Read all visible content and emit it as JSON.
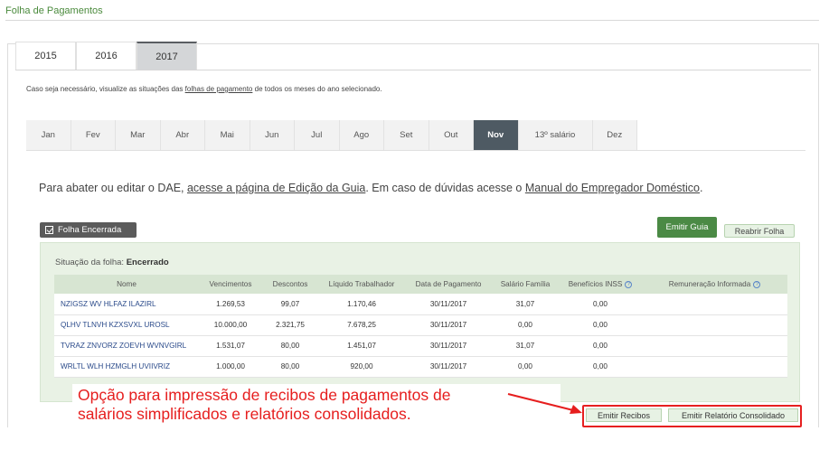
{
  "page_title": "Folha de Pagamentos",
  "year_tabs": [
    "2015",
    "2016",
    "2017"
  ],
  "active_year": "2017",
  "info": {
    "prefix": "Caso seja necessário, visualize as situações das ",
    "link": "folhas de pagamento",
    "suffix": " de todos os meses do ano selecionado."
  },
  "month_tabs": [
    "Jan",
    "Fev",
    "Mar",
    "Abr",
    "Mai",
    "Jun",
    "Jul",
    "Ago",
    "Set",
    "Out",
    "Nov",
    "13º salário",
    "Dez"
  ],
  "active_month": "Nov",
  "dae": {
    "prefix": "Para abater ou editar o DAE, ",
    "link1": "acesse a página de Edição da Guia",
    "middle": ". Em caso de dúvidas acesse o ",
    "link2": "Manual do Empregador Doméstico",
    "suffix": "."
  },
  "status_badge": "Folha Encerrada",
  "buttons": {
    "emitir_guia": "Emitir Guia",
    "reabrir_folha": "Reabrir Folha",
    "emitir_recibos": "Emitir Recibos",
    "emitir_relatorio": "Emitir Relatório Consolidado"
  },
  "situacao": {
    "label": "Situação da folha: ",
    "value": "Encerrado"
  },
  "table": {
    "headers": [
      "Nome",
      "Vencimentos",
      "Descontos",
      "Líquido Trabalhador",
      "Data de Pagamento",
      "Salário Família",
      "Benefícios INSS",
      "Remuneração Informada"
    ],
    "help_icon": "?",
    "rows": [
      [
        "NZIGSZ WV HLFAZ ILAZIRL",
        "1.269,53",
        "99,07",
        "1.170,46",
        "30/11/2017",
        "31,07",
        "0,00",
        ""
      ],
      [
        "QLHV TLNVH KZXSVXL UROSL",
        "10.000,00",
        "2.321,75",
        "7.678,25",
        "30/11/2017",
        "0,00",
        "0,00",
        ""
      ],
      [
        "TVRAZ ZNVORZ ZOEVH WVNVGIRL",
        "1.531,07",
        "80,00",
        "1.451,07",
        "30/11/2017",
        "31,07",
        "0,00",
        ""
      ],
      [
        "WRLTL WLH HZMGLH UVIIVRIZ",
        "1.000,00",
        "80,00",
        "920,00",
        "30/11/2017",
        "0,00",
        "0,00",
        ""
      ]
    ]
  },
  "annotation": {
    "line1": "Opção para impressão de recibos de pagamentos de",
    "line2": "salários simplificados e relatórios consolidados."
  },
  "colors": {
    "accent_green": "#4b8a45",
    "annotation_red": "#e61e1e",
    "active_month_bg": "#4e5a63"
  }
}
